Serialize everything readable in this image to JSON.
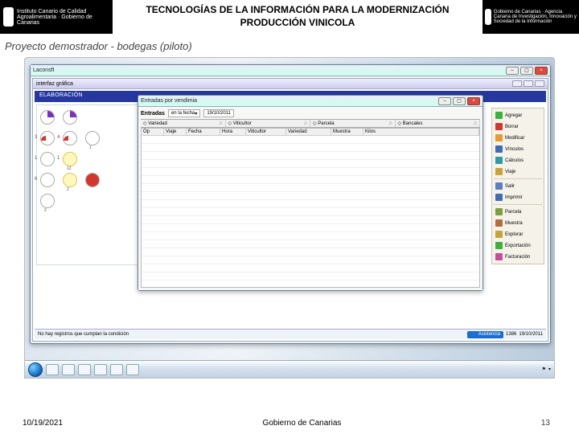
{
  "header": {
    "title_line1": "TECNOLOGÍAS DE LA INFORMACIÓN PARA LA MODERNIZACIÓN",
    "title_line2": "PRODUCCIÓN VINICOLA",
    "logo_left": "Instituto Canario de Calidad Agroalimentaria · Gobierno de Canarias",
    "logo_right": "Gobierno de Canarias · Agencia Canaria de Investigación, Innovación y Sociedad de la Información"
  },
  "subtitle": "Proyecto demostrador - bodegas (piloto)",
  "outer_window": {
    "title": "Laconsft"
  },
  "doc_window": {
    "title": "interfaz gráfica",
    "blue_bar": "ELABORACIÓN"
  },
  "tanks": {
    "rows": [
      [
        {
          "n": "",
          "lbl": "",
          "cls": "purple"
        },
        {
          "n": "",
          "lbl": "",
          "cls": "purple"
        }
      ],
      [
        {
          "n": "3",
          "lbl": "",
          "cls": "red-wedge"
        },
        {
          "n": "4",
          "lbl": "",
          "cls": "red-wedge"
        },
        {
          "n": "",
          "lbl": "1",
          "cls": ""
        }
      ],
      [
        {
          "n": "1",
          "lbl": "",
          "cls": ""
        },
        {
          "n": "1",
          "lbl": "12",
          "cls": "yellow"
        }
      ],
      [
        {
          "n": "6",
          "lbl": "",
          "cls": ""
        },
        {
          "n": "",
          "lbl": "2",
          "cls": "yellow"
        },
        {
          "n": "",
          "lbl": "",
          "cls": "red-full"
        }
      ],
      [
        {
          "n": "",
          "lbl": "2",
          "cls": ""
        }
      ]
    ]
  },
  "entry_window": {
    "title": "Entradas por vendimia",
    "filters": {
      "label": "Entradas",
      "date_mode": "en la fecha",
      "date_value": "19/10/2011"
    },
    "header_cols": [
      "Variedad",
      "Viticultor",
      "Parcela",
      "Bancales"
    ],
    "grid_cols": [
      "Op",
      "Viaje",
      "Fecha",
      "Hora",
      "Viticultor",
      "Variedad",
      "Muestra",
      "Kilos"
    ]
  },
  "toolbar": {
    "items": [
      {
        "label": "Agregar",
        "color": "#3bb23b"
      },
      {
        "label": "Borrar",
        "color": "#d4352c"
      },
      {
        "label": "Modificar",
        "color": "#e39c2e"
      },
      {
        "label": "Vínculos",
        "color": "#3f6db5"
      },
      {
        "label": "Cálculos",
        "color": "#2f9aa5"
      },
      {
        "label": "Viaje",
        "color": "#caa23a"
      },
      {
        "label": "Salir",
        "color": "#5b7fbf"
      },
      {
        "label": "Imprimir",
        "color": "#3f6db5"
      },
      {
        "label": "Parcela",
        "color": "#7aa23a"
      },
      {
        "label": "Muestra",
        "color": "#b56d3f"
      },
      {
        "label": "Explorar",
        "color": "#caa23a"
      },
      {
        "label": "Exportación",
        "color": "#3bb23b"
      },
      {
        "label": "Facturación",
        "color": "#c94b9f"
      }
    ],
    "separators_after": [
      5,
      7
    ]
  },
  "statusbar": {
    "left": "No hay registros que cumplan la condición",
    "count": "1386",
    "date": "19/10/2011",
    "assist": "Asistencia"
  },
  "tray": {
    "time": "",
    "date": ""
  },
  "footer": {
    "date": "10/19/2021",
    "org": "Gobierno de Canarias",
    "page": "13"
  }
}
